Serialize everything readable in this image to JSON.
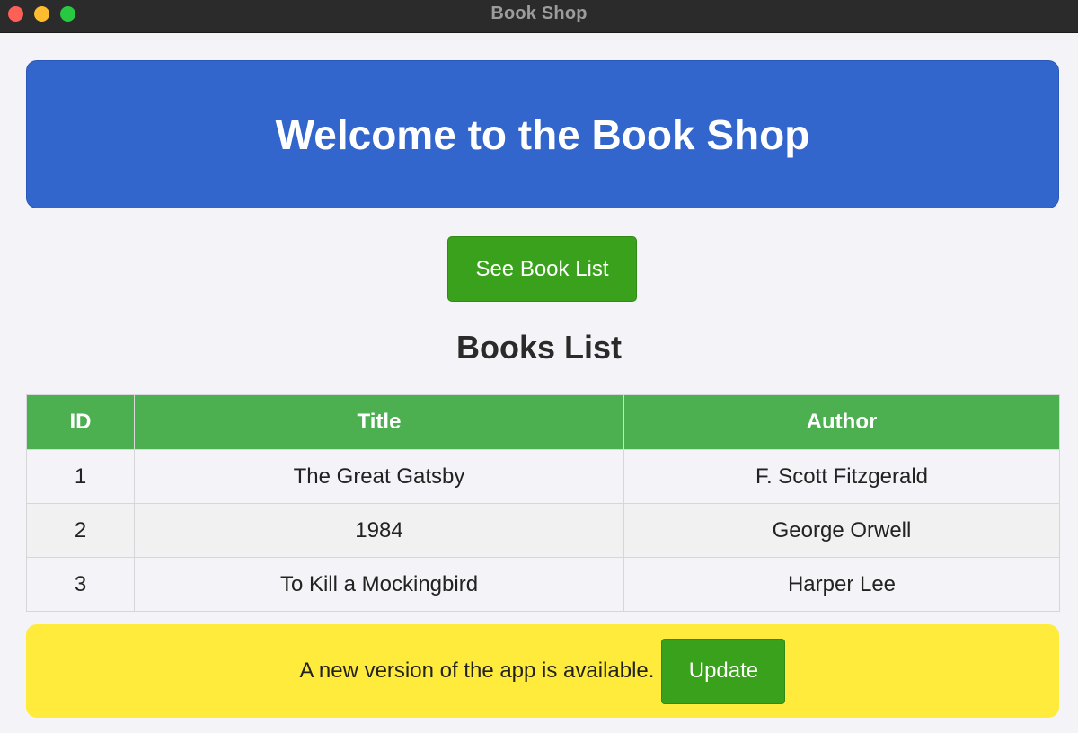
{
  "window": {
    "title": "Book Shop"
  },
  "hero": {
    "heading": "Welcome to the Book Shop"
  },
  "actions": {
    "see_books_label": "See Book List"
  },
  "books": {
    "heading": "Books List",
    "columns": [
      "ID",
      "Title",
      "Author"
    ],
    "rows": [
      {
        "id": "1",
        "title": "The Great Gatsby",
        "author": "F. Scott Fitzgerald"
      },
      {
        "id": "2",
        "title": "1984",
        "author": "George Orwell"
      },
      {
        "id": "3",
        "title": "To Kill a Mockingbird",
        "author": "Harper Lee"
      }
    ]
  },
  "notice": {
    "message": "A new version of the app is available.",
    "button_label": "Update"
  },
  "colors": {
    "hero_blue": "#3266cc",
    "button_green": "#3aa11c",
    "table_header_green": "#4caf50",
    "notice_yellow": "#ffeb3b",
    "page_background": "#f4f4f8"
  }
}
